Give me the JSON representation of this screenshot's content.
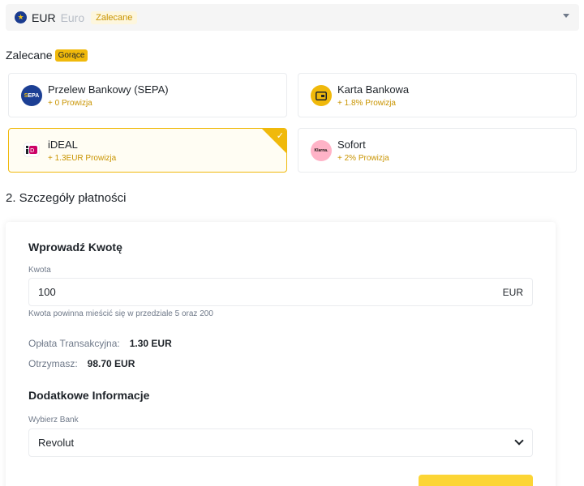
{
  "currency": {
    "code": "EUR",
    "name": "Euro",
    "badge": "Zalecane",
    "icon": "euro-flag-icon"
  },
  "recommended": {
    "title": "Zalecane",
    "hot_badge": "Gorące"
  },
  "payment_methods": [
    {
      "name": "Przelew Bankowy (SEPA)",
      "fee": "+ 0 Prowizja",
      "icon": "sepa-icon",
      "selected": false
    },
    {
      "name": "Karta Bankowa",
      "fee": "+ 1.8% Prowizja",
      "icon": "card-icon",
      "selected": false
    },
    {
      "name": "iDEAL",
      "fee": "+ 1.3EUR Prowizja",
      "icon": "ideal-icon",
      "selected": true
    },
    {
      "name": "Sofort",
      "fee": "+ 2% Prowizja",
      "icon": "klarna-icon",
      "selected": false
    }
  ],
  "sepa_logo": {
    "s": "S",
    "rest": "EPA"
  },
  "klarna_logo": "Klarna.",
  "details": {
    "section_title": "2. Szczegóły płatności",
    "heading": "Wprowadź Kwotę",
    "amount_label": "Kwota",
    "amount_value": "100",
    "amount_unit": "EUR",
    "amount_hint": "Kwota powinna mieścić się w przedziale 5 oraz 200",
    "fee_label": "Opłata Transakcyjna:",
    "fee_value": "1.30 EUR",
    "receive_label": "Otrzymasz:",
    "receive_value": "98.70 EUR",
    "extra_heading": "Dodatkowe Informacje",
    "bank_label": "Wybierz Bank",
    "bank_value": "Revolut"
  },
  "colors": {
    "accent": "#F0B90B",
    "button": "#FCD535",
    "fee_text": "#C99400"
  }
}
